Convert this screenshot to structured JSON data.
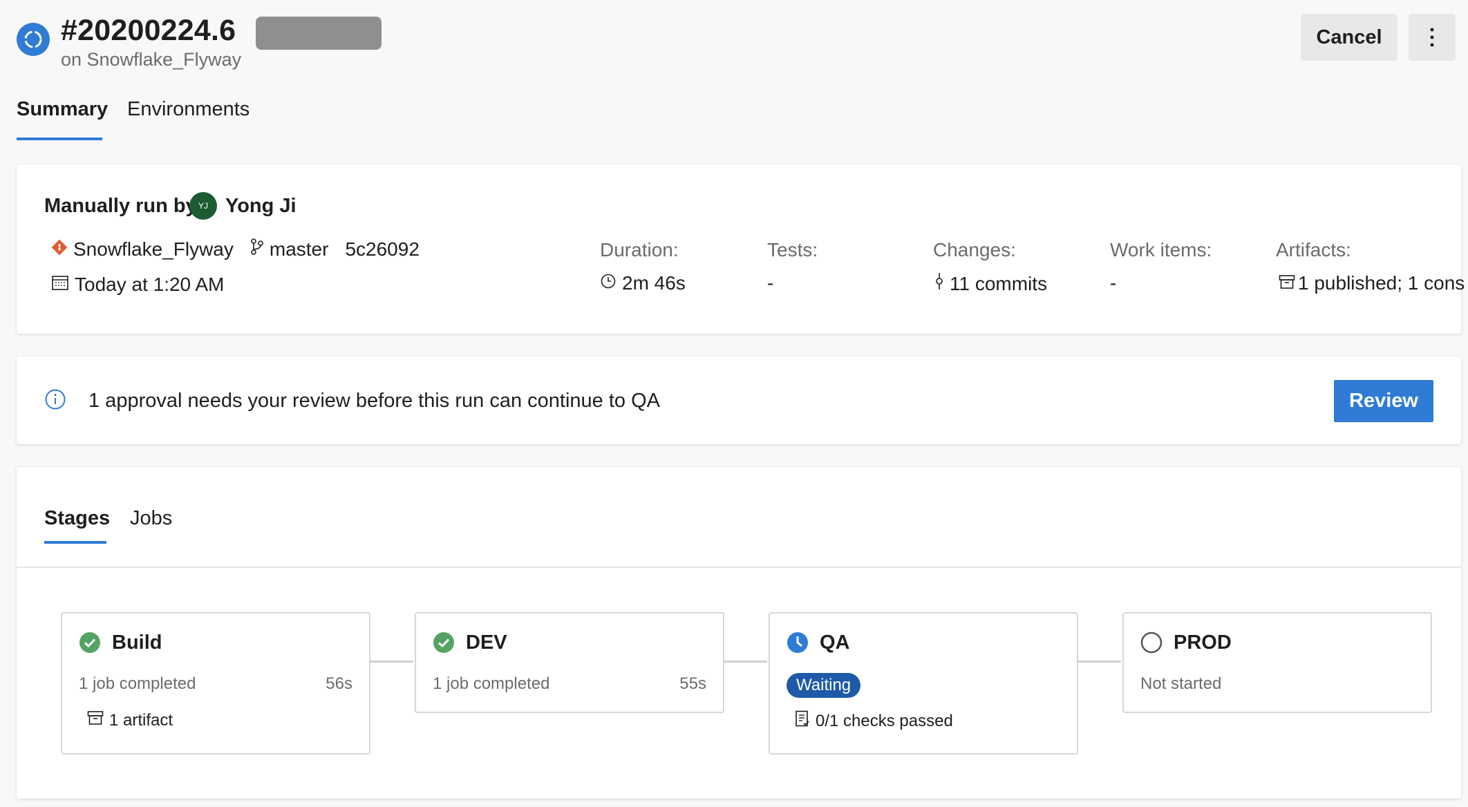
{
  "header": {
    "run_number": "#20200224.6",
    "pipeline_sub": "on Snowflake_Flyway",
    "cancel_label": "Cancel",
    "more_icon": "more-vertical-icon"
  },
  "tabs": [
    {
      "label": "Summary",
      "active": true
    },
    {
      "label": "Environments",
      "active": false
    }
  ],
  "summary": {
    "run_by_label": "Manually run by",
    "avatar_initials": "YJ",
    "user_name": "Yong Ji",
    "repo": "Snowflake_Flyway",
    "branch": "master",
    "commit": "5c26092",
    "date": "Today at 1:20 AM",
    "stats": {
      "duration_label": "Duration:",
      "duration_value": "2m 46s",
      "tests_label": "Tests:",
      "tests_value": "-",
      "changes_label": "Changes:",
      "changes_value": "11 commits",
      "work_items_label": "Work items:",
      "work_items_value": "-",
      "artifacts_label": "Artifacts:",
      "artifacts_value": "1 published; 1 cons"
    }
  },
  "approval": {
    "message": "1 approval needs your review before this run can continue to QA",
    "review_label": "Review"
  },
  "stages_panel": {
    "tabs": [
      {
        "label": "Stages",
        "active": true
      },
      {
        "label": "Jobs",
        "active": false
      }
    ],
    "stages": [
      {
        "name": "Build",
        "status": "succeeded",
        "jobs": "1 job completed",
        "duration": "56s",
        "detail": "1 artifact"
      },
      {
        "name": "DEV",
        "status": "succeeded",
        "jobs": "1 job completed",
        "duration": "55s"
      },
      {
        "name": "QA",
        "status": "waiting",
        "badge": "Waiting",
        "detail": "0/1 checks passed"
      },
      {
        "name": "PROD",
        "status": "not-started",
        "jobs": "Not started"
      }
    ]
  },
  "colors": {
    "accent": "#2f7bd6",
    "success": "#55a362",
    "waiting_badge": "#1e5aa8",
    "avatar": "#1d5b33",
    "repo_icon": "#e05c35"
  }
}
